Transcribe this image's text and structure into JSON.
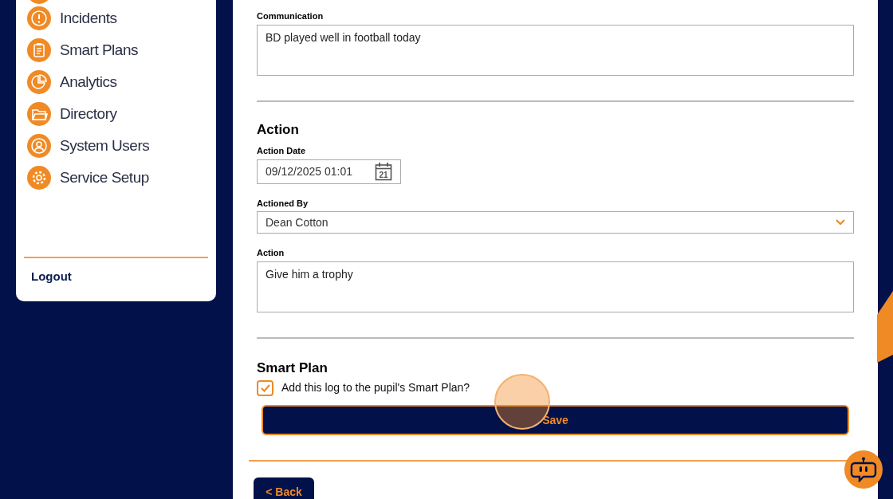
{
  "sidebar": {
    "items": [
      {
        "label": "Incidents"
      },
      {
        "label": "Smart Plans"
      },
      {
        "label": "Analytics"
      },
      {
        "label": "Directory"
      },
      {
        "label": "System Users"
      },
      {
        "label": "Service Setup"
      }
    ],
    "logout": "Logout"
  },
  "form": {
    "communication": {
      "label": "Communication",
      "value": "BD played well in football today"
    },
    "action_section": {
      "heading": "Action",
      "action_date": {
        "label": "Action Date",
        "value": "09/12/2025 01:01",
        "calendar_day": "21"
      },
      "actioned_by": {
        "label": "Actioned By",
        "value": "Dean Cotton"
      },
      "action": {
        "label": "Action",
        "value": "Give him a trophy"
      }
    },
    "smart_plan": {
      "heading": "Smart Plan",
      "checkbox_label": "Add this log to the pupil's Smart Plan?",
      "checked": true
    },
    "save_button": "Save",
    "back_button": "< Back"
  }
}
